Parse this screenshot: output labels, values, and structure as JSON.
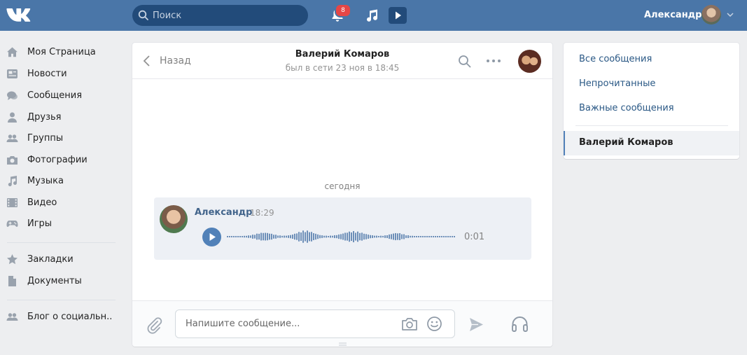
{
  "header": {
    "logo": "vk-logo",
    "search_placeholder": "Поиск",
    "notifications_count": "8",
    "username": "Александр"
  },
  "nav": {
    "items": [
      {
        "label": "Моя Страница",
        "icon": "home-icon"
      },
      {
        "label": "Новости",
        "icon": "news-icon"
      },
      {
        "label": "Сообщения",
        "icon": "messages-icon"
      },
      {
        "label": "Друзья",
        "icon": "friend-icon"
      },
      {
        "label": "Группы",
        "icon": "groups-icon"
      },
      {
        "label": "Фотографии",
        "icon": "camera-icon"
      },
      {
        "label": "Музыка",
        "icon": "music-icon"
      },
      {
        "label": "Видео",
        "icon": "video-icon"
      },
      {
        "label": "Игры",
        "icon": "gamepad-icon"
      }
    ],
    "items2": [
      {
        "label": "Закладки",
        "icon": "star-icon"
      },
      {
        "label": "Документы",
        "icon": "document-icon"
      }
    ],
    "items3": [
      {
        "label": "Блог о социальн..",
        "icon": "groups-icon"
      }
    ]
  },
  "chat": {
    "back_label": "Назад",
    "peer_name": "Валерий Комаров",
    "peer_status": "был в сети 23 ноя в 18:45",
    "date_separator": "сегодня",
    "message": {
      "author": "Александр",
      "time": "18:29",
      "voice_duration": "0:01"
    },
    "composer_placeholder": "Напишите сообщение..."
  },
  "filters": {
    "all": "Все сообщения",
    "unread": "Непрочитанные",
    "important": "Важные сообщения",
    "active_dialog": "Валерий Комаров"
  },
  "colors": {
    "header_bg": "#4a76a8",
    "accent": "#5181b8",
    "link": "#2a5885",
    "author": "#42648b"
  }
}
